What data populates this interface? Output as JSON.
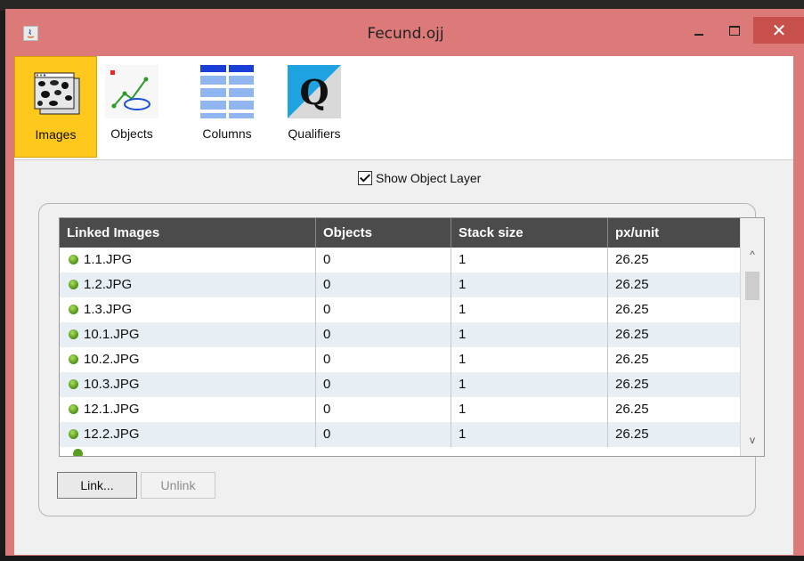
{
  "window": {
    "title": "Fecund.ojj",
    "controls": {
      "minimize": "minimize",
      "maximize": "maximize",
      "close": "✕"
    }
  },
  "toolbar": {
    "items": [
      {
        "label": "Images",
        "selected": true,
        "icon": "images-icon"
      },
      {
        "label": "Objects",
        "selected": false,
        "icon": "objects-icon"
      },
      {
        "label": "Columns",
        "selected": false,
        "icon": "columns-icon"
      },
      {
        "label": "Qualifiers",
        "selected": false,
        "icon": "qualifiers-icon"
      }
    ],
    "qualifier_glyph": "Q"
  },
  "options": {
    "show_object_layer_label": "Show Object Layer",
    "show_object_layer_checked": true
  },
  "table": {
    "columns": [
      "Linked Images",
      "Objects",
      "Stack size",
      "px/unit"
    ],
    "rows": [
      [
        "1.1.JPG",
        "0",
        "1",
        "26.25"
      ],
      [
        "1.2.JPG",
        "0",
        "1",
        "26.25"
      ],
      [
        "1.3.JPG",
        "0",
        "1",
        "26.25"
      ],
      [
        "10.1.JPG",
        "0",
        "1",
        "26.25"
      ],
      [
        "10.2.JPG",
        "0",
        "1",
        "26.25"
      ],
      [
        "10.3.JPG",
        "0",
        "1",
        "26.25"
      ],
      [
        "12.1.JPG",
        "0",
        "1",
        "26.25"
      ],
      [
        "12.2.JPG",
        "0",
        "1",
        "26.25"
      ]
    ],
    "scroll_up": "^",
    "scroll_down": "v"
  },
  "buttons": {
    "link_label": "Link...",
    "unlink_label": "Unlink"
  },
  "colors": {
    "titlebar": "#dc7a79",
    "close": "#c7504d",
    "selected_tool": "#ffc81c",
    "header": "#4b4b4b",
    "row_alt": "#e7eef4"
  }
}
